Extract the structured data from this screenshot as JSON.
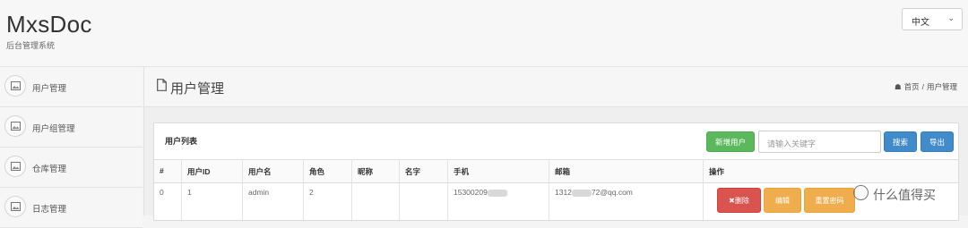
{
  "header": {
    "logo": "MxsDoc",
    "subtitle": "后台管理系统",
    "language": "中文"
  },
  "sidebar": {
    "items": [
      {
        "label": "用户管理",
        "icon": "image-icon"
      },
      {
        "label": "用户组管理",
        "icon": "image-icon"
      },
      {
        "label": "仓库管理",
        "icon": "image-icon"
      },
      {
        "label": "日志管理",
        "icon": "image-icon"
      }
    ]
  },
  "page": {
    "title": "用户管理",
    "breadcrumb": {
      "home": "首页",
      "separator": "/",
      "current": "用户管理"
    }
  },
  "panel": {
    "title": "用户列表",
    "add_button": "新增用户",
    "search_placeholder": "请输入关键字",
    "search_button": "搜索",
    "export_button": "导出"
  },
  "table": {
    "columns": [
      "#",
      "用户ID",
      "用户名",
      "角色",
      "昵称",
      "名字",
      "手机",
      "邮箱",
      "操作"
    ],
    "rows": [
      {
        "index": "0",
        "user_id": "1",
        "username": "admin",
        "role": "2",
        "nickname": "",
        "name": "",
        "phone": "15300209",
        "email_prefix": "1312",
        "email_suffix": "72@qq.com",
        "actions": {
          "delete": "删除",
          "edit": "编辑",
          "reset": "重置密码"
        }
      }
    ]
  },
  "watermark": {
    "text": "什么值得买",
    "glyph": "值"
  },
  "colors": {
    "success": "#5cb85c",
    "primary": "#428bca",
    "danger": "#d9534f",
    "warning": "#f0ad4e"
  }
}
